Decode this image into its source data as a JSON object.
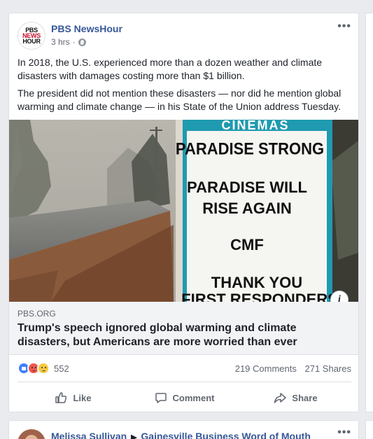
{
  "post": {
    "page_name": "PBS NewsHour",
    "logo_lines": [
      "PBS",
      "NEWS",
      "HOUR"
    ],
    "time": "3 hrs",
    "more": "•••",
    "paragraphs": [
      "In 2018, the U.S. experienced more than a dozen weather and climate disasters with damages costing more than $1 billion.",
      "The president did not mention these disasters — nor did he mention global warming and climate change — in his State of the Union address Tuesday."
    ],
    "image": {
      "sign_header": "CINEMAS",
      "sign_lines": [
        "PARADISE STRONG",
        "PARADISE WILL",
        "RISE  AGAIN",
        "CMF",
        "THANK YOU",
        "FIRST  RESPONDERS"
      ]
    },
    "link": {
      "domain": "PBS.ORG",
      "headline": "Trump's speech ignored global warming and climate disasters, but Americans are more worried than ever"
    },
    "reactions": {
      "count": "552",
      "comments": "219 Comments",
      "shares": "271 Shares"
    },
    "actions": {
      "like": "Like",
      "comment": "Comment",
      "share": "Share"
    },
    "colors": {
      "link_blue": "#365899",
      "background": "#e9ebee",
      "sign_teal": "#1f9ab0"
    }
  },
  "next_post": {
    "author": "Melissa Sullivan",
    "arrow": "▶",
    "group": "Gainesville Business Word of Mouth",
    "more": "•••"
  }
}
